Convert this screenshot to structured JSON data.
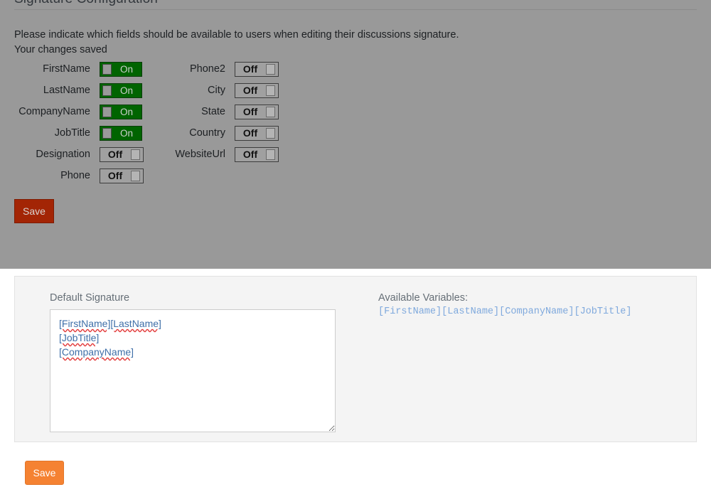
{
  "panel": {
    "title": "Signature Configuration",
    "intro_text": "Please indicate which fields should be available to users when editing their discussions signature.",
    "status_text": "Your changes saved",
    "save_label": "Save"
  },
  "fields": {
    "left_column": [
      {
        "label": "FirstName",
        "state": "On"
      },
      {
        "label": "LastName",
        "state": "On"
      },
      {
        "label": "CompanyName",
        "state": "On"
      },
      {
        "label": "JobTitle",
        "state": "On"
      },
      {
        "label": "Designation",
        "state": "Off"
      },
      {
        "label": "Phone",
        "state": "Off"
      }
    ],
    "right_column": [
      {
        "label": "Phone2",
        "state": "Off"
      },
      {
        "label": "City",
        "state": "Off"
      },
      {
        "label": "State",
        "state": "Off"
      },
      {
        "label": "Country",
        "state": "Off"
      },
      {
        "label": "WebsiteUrl",
        "state": "Off"
      }
    ]
  },
  "signature": {
    "default_signature_label": "Default Signature",
    "textarea_value": "[FirstName][LastName]\n[JobTitle]\n[CompanyName]",
    "textarea_lines": [
      "[FirstName][LastName]",
      "[JobTitle]",
      "[CompanyName]"
    ],
    "available_variables_label": "Available Variables:",
    "available_variables": [
      "[FirstName]",
      "[LastName]",
      "[CompanyName]",
      "[JobTitle]"
    ],
    "save_label": "Save"
  },
  "colors": {
    "panel_background": "#999999",
    "toggle_on": "#006400",
    "toggle_off": "#a0a0a0",
    "save_config_button": "#a32505",
    "save_signature_button": "#f58232",
    "signature_panel": "#f4f4f4",
    "variable_token": "#7fa9dd",
    "spellcheck_underline": "#e33a3a"
  }
}
